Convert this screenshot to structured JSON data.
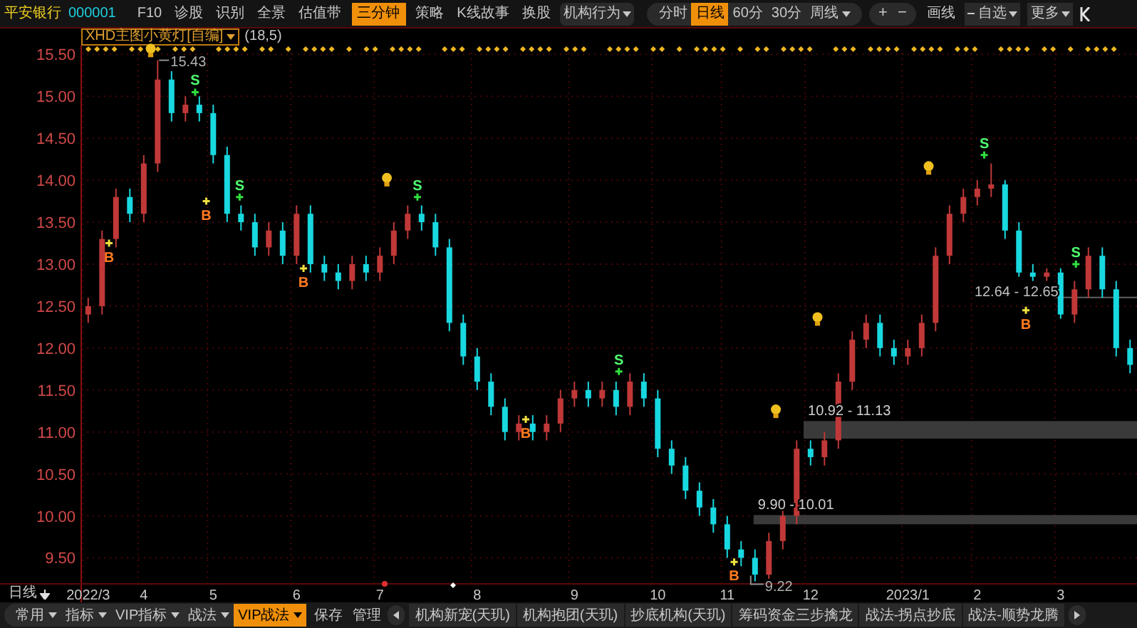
{
  "stock": {
    "name": "平安银行",
    "code": "000001"
  },
  "toolbar": [
    {
      "label": "F10",
      "selected": false,
      "dropdown": false
    },
    {
      "label": "诊股",
      "selected": false,
      "dropdown": false
    },
    {
      "label": "识别",
      "selected": false,
      "dropdown": false
    },
    {
      "label": "全景",
      "selected": false,
      "dropdown": false
    },
    {
      "label": "估值带",
      "selected": false,
      "dropdown": false
    },
    {
      "label": "三分钟",
      "selected": true,
      "dropdown": false
    },
    {
      "label": "策略",
      "selected": false,
      "dropdown": false
    },
    {
      "label": "K线故事",
      "selected": false,
      "dropdown": false
    },
    {
      "label": "换股",
      "selected": false,
      "dropdown": false
    },
    {
      "label": "机构行为",
      "selected": false,
      "dropdown": true
    }
  ],
  "period_tabs": [
    {
      "label": "分时",
      "selected": false,
      "dropdown": false
    },
    {
      "label": "日线",
      "selected": true,
      "dropdown": false
    },
    {
      "label": "60分",
      "selected": false,
      "dropdown": false
    },
    {
      "label": "30分",
      "selected": false,
      "dropdown": false
    },
    {
      "label": "周线",
      "selected": false,
      "dropdown": true
    }
  ],
  "zoom_buttons": [
    "+",
    "−"
  ],
  "right_tools": [
    {
      "label": "画线",
      "dropdown": false
    },
    {
      "label": "自选",
      "dropdown": true
    },
    {
      "label": "更多",
      "dropdown": true
    }
  ],
  "indicator": {
    "name": "XHD主图小黄灯[自编]",
    "params": "(18,5)"
  },
  "chart": {
    "chart_data": {
      "type": "candlestick",
      "grid": true,
      "categories": [
        "2022/3",
        null,
        null,
        null,
        "4",
        null,
        null,
        null,
        null,
        "5",
        null,
        null,
        null,
        null,
        null,
        "6",
        null,
        null,
        null,
        null,
        null,
        "7",
        null,
        null,
        null,
        null,
        null,
        null,
        "8",
        null,
        null,
        null,
        null,
        null,
        null,
        "9",
        null,
        null,
        null,
        null,
        null,
        "10",
        null,
        null,
        null,
        null,
        "11",
        null,
        null,
        null,
        null,
        null,
        "12",
        null,
        null,
        null,
        null,
        null,
        null,
        "2023/1",
        null,
        null,
        null,
        null,
        "2",
        null,
        null,
        null,
        null,
        null,
        "3",
        null,
        null,
        null,
        null,
        null
      ],
      "ohlc": [
        [
          12.4,
          12.6,
          12.3,
          12.5
        ],
        [
          12.5,
          13.4,
          12.4,
          13.3
        ],
        [
          13.3,
          13.9,
          13.2,
          13.8
        ],
        [
          13.8,
          13.9,
          13.5,
          13.6
        ],
        [
          13.6,
          14.3,
          13.5,
          14.2
        ],
        [
          14.2,
          15.43,
          14.1,
          15.2
        ],
        [
          15.2,
          15.3,
          14.7,
          14.8
        ],
        [
          14.8,
          15.0,
          14.7,
          14.9
        ],
        [
          14.9,
          15.0,
          14.7,
          14.8
        ],
        [
          14.8,
          14.9,
          14.2,
          14.3
        ],
        [
          14.3,
          14.4,
          13.5,
          13.6
        ],
        [
          13.6,
          13.7,
          13.4,
          13.5
        ],
        [
          13.5,
          13.6,
          13.1,
          13.2
        ],
        [
          13.2,
          13.5,
          13.1,
          13.4
        ],
        [
          13.4,
          13.5,
          13.0,
          13.1
        ],
        [
          13.1,
          13.7,
          13.0,
          13.6
        ],
        [
          13.6,
          13.7,
          12.9,
          13.0
        ],
        [
          13.0,
          13.1,
          12.8,
          12.9
        ],
        [
          12.9,
          13.0,
          12.7,
          12.8
        ],
        [
          12.8,
          13.1,
          12.7,
          13.0
        ],
        [
          13.0,
          13.1,
          12.8,
          12.9
        ],
        [
          12.9,
          13.2,
          12.8,
          13.1
        ],
        [
          13.1,
          13.5,
          13.0,
          13.4
        ],
        [
          13.4,
          13.7,
          13.3,
          13.6
        ],
        [
          13.6,
          13.7,
          13.4,
          13.5
        ],
        [
          13.5,
          13.6,
          13.1,
          13.2
        ],
        [
          13.2,
          13.3,
          12.2,
          12.3
        ],
        [
          12.3,
          12.4,
          11.8,
          11.9
        ],
        [
          11.9,
          12.0,
          11.5,
          11.6
        ],
        [
          11.6,
          11.7,
          11.2,
          11.3
        ],
        [
          11.3,
          11.4,
          10.9,
          11.0
        ],
        [
          11.0,
          11.2,
          10.9,
          11.1
        ],
        [
          11.1,
          11.2,
          10.9,
          11.0
        ],
        [
          11.0,
          11.2,
          10.9,
          11.1
        ],
        [
          11.1,
          11.5,
          11.0,
          11.4
        ],
        [
          11.4,
          11.6,
          11.3,
          11.5
        ],
        [
          11.5,
          11.6,
          11.3,
          11.4
        ],
        [
          11.4,
          11.6,
          11.3,
          11.5
        ],
        [
          11.5,
          11.6,
          11.2,
          11.3
        ],
        [
          11.3,
          11.7,
          11.2,
          11.6
        ],
        [
          11.6,
          11.7,
          11.3,
          11.4
        ],
        [
          11.4,
          11.5,
          10.7,
          10.8
        ],
        [
          10.8,
          10.9,
          10.5,
          10.6
        ],
        [
          10.6,
          10.7,
          10.2,
          10.3
        ],
        [
          10.3,
          10.4,
          10.0,
          10.1
        ],
        [
          10.1,
          10.2,
          9.8,
          9.9
        ],
        [
          9.9,
          10.0,
          9.5,
          9.6
        ],
        [
          9.6,
          9.7,
          9.4,
          9.5
        ],
        [
          9.5,
          9.6,
          9.22,
          9.3
        ],
        [
          9.3,
          9.8,
          9.25,
          9.7
        ],
        [
          9.7,
          10.1,
          9.6,
          10.0
        ],
        [
          10.0,
          10.9,
          9.9,
          10.8
        ],
        [
          10.8,
          10.9,
          10.6,
          10.7
        ],
        [
          10.7,
          11.0,
          10.6,
          10.9
        ],
        [
          10.9,
          11.7,
          10.8,
          11.6
        ],
        [
          11.6,
          12.2,
          11.5,
          12.1
        ],
        [
          12.1,
          12.4,
          12.0,
          12.3
        ],
        [
          12.3,
          12.4,
          11.9,
          12.0
        ],
        [
          12.0,
          12.1,
          11.8,
          11.9
        ],
        [
          11.9,
          12.1,
          11.8,
          12.0
        ],
        [
          12.0,
          12.4,
          11.9,
          12.3
        ],
        [
          12.3,
          13.2,
          12.2,
          13.1
        ],
        [
          13.1,
          13.7,
          13.0,
          13.6
        ],
        [
          13.6,
          13.9,
          13.5,
          13.8
        ],
        [
          13.8,
          14.0,
          13.7,
          13.9
        ],
        [
          13.9,
          14.2,
          13.8,
          13.95
        ],
        [
          13.95,
          14.0,
          13.3,
          13.4
        ],
        [
          13.4,
          13.5,
          12.85,
          12.9
        ],
        [
          12.9,
          13.0,
          12.8,
          12.85
        ],
        [
          12.85,
          12.95,
          12.8,
          12.9
        ],
        [
          12.9,
          12.95,
          12.35,
          12.4
        ],
        [
          12.4,
          12.8,
          12.3,
          12.7
        ],
        [
          12.7,
          13.2,
          12.6,
          13.1
        ],
        [
          13.1,
          13.2,
          12.6,
          12.7
        ],
        [
          12.7,
          12.8,
          11.9,
          12.0
        ],
        [
          12.0,
          12.1,
          11.7,
          11.8
        ]
      ],
      "ylim": [
        9.19,
        15.52
      ],
      "yticks": [
        {
          "value": 9.5,
          "label": "9.50"
        },
        {
          "value": 10,
          "label": "10.00"
        },
        {
          "value": 10.5,
          "label": "10.50"
        },
        {
          "value": 11,
          "label": "11.00"
        },
        {
          "value": 11.5,
          "label": "11.50"
        },
        {
          "value": 12,
          "label": "12.00"
        },
        {
          "value": 12.5,
          "label": "12.50"
        },
        {
          "value": 13,
          "label": "13.00"
        },
        {
          "value": 13.5,
          "label": "13.50"
        },
        {
          "value": 14,
          "label": "14.00"
        },
        {
          "value": 14.5,
          "label": "14.50"
        },
        {
          "value": 15,
          "label": "15.00"
        },
        {
          "value": 15.5,
          "label": "15.50"
        }
      ],
      "bands": [
        {
          "axis": "y",
          "from": 10.92,
          "to": 11.13,
          "label": "10.92 - 11.13"
        },
        {
          "axis": "y",
          "from": 9.9,
          "to": 10.01,
          "label": "9.90 - 10.01"
        }
      ]
    },
    "price_labels": {
      "high": "15.43",
      "low": "9.22",
      "range": "12.64 - 12.65"
    },
    "signals": [
      {
        "kind": "buy",
        "label": "B"
      },
      {
        "kind": "buy",
        "label": "B"
      },
      {
        "kind": "buy",
        "label": "B"
      },
      {
        "kind": "buy",
        "label": "B"
      },
      {
        "kind": "buy",
        "label": "B"
      },
      {
        "kind": "buy",
        "label": "B"
      },
      {
        "kind": "sell",
        "label": "S"
      },
      {
        "kind": "sell",
        "label": "S"
      },
      {
        "kind": "sell",
        "label": "S"
      },
      {
        "kind": "sell",
        "label": "S"
      },
      {
        "kind": "sell",
        "label": "S"
      },
      {
        "kind": "sell",
        "label": "S"
      },
      {
        "kind": "bulb"
      },
      {
        "kind": "bulb"
      },
      {
        "kind": "bulb"
      },
      {
        "kind": "bulb"
      },
      {
        "kind": "bulb"
      }
    ]
  },
  "period_label": "日线",
  "bottom_menus": [
    {
      "label": "常用",
      "selected": false
    },
    {
      "label": "指标",
      "selected": false
    },
    {
      "label": "VIP指标",
      "selected": false
    },
    {
      "label": "战法",
      "selected": false
    },
    {
      "label": "VIP战法",
      "selected": true
    }
  ],
  "bottom_actions": [
    "保存",
    "管理"
  ],
  "strategy_tabs": [
    "机构新宠(天玑)",
    "机构抱团(天玑)",
    "抄底机构(天玑)",
    "筹码资金三步擒龙",
    "战法-拐点抄底",
    "战法-顺势龙腾"
  ]
}
